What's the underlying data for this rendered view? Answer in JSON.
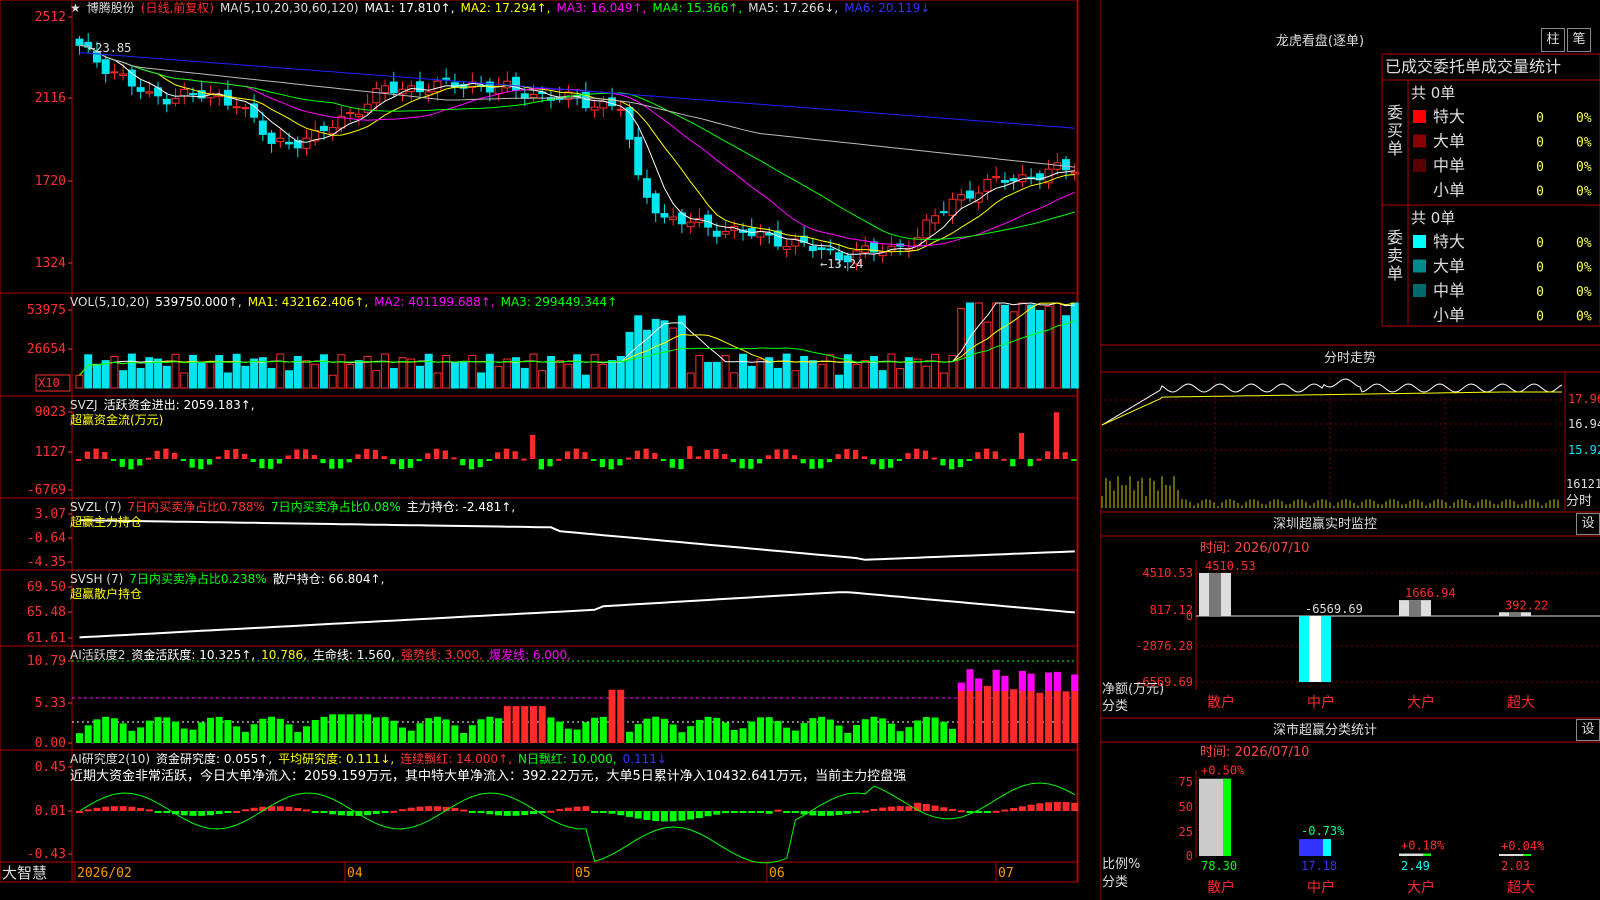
{
  "stock": {
    "name": "博腾股份",
    "mode": "(日线,前复权)"
  },
  "colors": {
    "up": "#ff2a2a",
    "down": "#00e5ee",
    "green": "#00ff00",
    "yellow": "#ffff00",
    "magenta": "#ff00ff",
    "white": "#ffffff",
    "blue": "#2020ff",
    "grid": "#b00000",
    "axis": "#ff3030"
  },
  "main_panel": {
    "ma_text": [
      {
        "t": "MA(5,10,20,30,60,120)",
        "c": "#dddddd"
      },
      {
        "t": "MA1: 17.810↑,",
        "c": "#ffffff"
      },
      {
        "t": "MA2: 17.294↑,",
        "c": "#ffff00"
      },
      {
        "t": "MA3: 16.049↑,",
        "c": "#ff00ff"
      },
      {
        "t": "MA4: 15.366↑,",
        "c": "#00ff00"
      },
      {
        "t": "MA5: 17.266↓,",
        "c": "#dddddd"
      },
      {
        "t": "MA6: 20.119↓",
        "c": "#3333ff"
      }
    ],
    "y_ticks": [
      "2512",
      "2116",
      "1720",
      "1324"
    ],
    "high_label": "23.85",
    "low_label": "13.24"
  },
  "vol_panel": {
    "text": [
      {
        "t": "VOL(5,10,20)",
        "c": "#dddddd"
      },
      {
        "t": "539750.000↑,",
        "c": "#ffffff"
      },
      {
        "t": "MA1: 432162.406↑,",
        "c": "#ffff00"
      },
      {
        "t": "MA2: 401199.688↑,",
        "c": "#ff00ff"
      },
      {
        "t": "MA3: 299449.344↑",
        "c": "#00ff00"
      }
    ],
    "y_ticks": [
      "53975",
      "26654"
    ],
    "unit": "X10"
  },
  "svzj_panel": {
    "line1": [
      {
        "t": "SVZJ",
        "c": "#dddddd"
      },
      {
        "t": "活跃资金进出: 2059.183↑,",
        "c": "#ffffff"
      }
    ],
    "line2": "超赢资金流(万元)",
    "y_ticks": [
      "9023",
      "1127",
      "-6769"
    ]
  },
  "svzl_panel": {
    "line1": [
      {
        "t": "SVZL (7)",
        "c": "#dddddd"
      },
      {
        "t": "7日内买卖净占比0.788%",
        "c": "#ff3030"
      },
      {
        "t": "7日内买卖净占比0.08%",
        "c": "#00ff00"
      },
      {
        "t": "主力持仓: -2.481↑,",
        "c": "#ffffff"
      }
    ],
    "line2": "超赢主力持仓",
    "y_ticks": [
      "3.07",
      "-0.64",
      "-4.35"
    ]
  },
  "svsh_panel": {
    "line1": [
      {
        "t": "SVSH (7)",
        "c": "#dddddd"
      },
      {
        "t": "7日内买卖净占比0.238%",
        "c": "#00ff00"
      },
      {
        "t": "散户持仓: 66.804↑,",
        "c": "#ffffff"
      }
    ],
    "line2": "超赢散户持仓",
    "y_ticks": [
      "69.50",
      "65.48",
      "61.61"
    ]
  },
  "ai_panel": {
    "line1": [
      {
        "t": "AI活跃度2",
        "c": "#dddddd"
      },
      {
        "t": "资金活跃度: 10.325↑,",
        "c": "#ffffff"
      },
      {
        "t": "10.786,",
        "c": "#ffff00"
      },
      {
        "t": "生命线: 1.560,",
        "c": "#ffffff"
      },
      {
        "t": "强势线: 3.000,",
        "c": "#ff3030"
      },
      {
        "t": "爆发线: 6.000,",
        "c": "#ff00ff"
      }
    ],
    "y_ticks": [
      "10.79",
      "5.33",
      "0.00"
    ]
  },
  "research_panel": {
    "line1": [
      {
        "t": "AI研究度2(10)",
        "c": "#dddddd"
      },
      {
        "t": "资金研究度: 0.055↑,",
        "c": "#ffffff"
      },
      {
        "t": "平均研究度: 0.111↓,",
        "c": "#ffff00"
      },
      {
        "t": "连续飘红: 14.000↑,",
        "c": "#ff3030"
      },
      {
        "t": "N日飘红: 10.000,",
        "c": "#00ff00"
      },
      {
        "t": "0.111↓",
        "c": "#3333ff"
      }
    ],
    "line2": "近期大资金非常活跃，今日大单净流入：2059.159万元，其中特大单净流入：392.22万元，大单5日累计净入10432.641万元，当前主力控盘强",
    "y_ticks": [
      "0.45",
      "0.01",
      "-0.43"
    ]
  },
  "date_axis": {
    "brand": "大智慧",
    "labels": [
      "2026/02",
      "04",
      "05",
      "06",
      "07"
    ]
  },
  "dragon_tiger": {
    "title": "龙虎看盘(逐单)",
    "btn_bar": "柱",
    "btn_pen": "笔",
    "header": "已成交委托单成交量统计",
    "buy": {
      "side": "委买单",
      "total": "共 0单",
      "rows": [
        {
          "label": "特大",
          "qty": "0",
          "pct": "0%",
          "c": "#ff0000"
        },
        {
          "label": "大单",
          "qty": "0",
          "pct": "0%",
          "c": "#8b0000"
        },
        {
          "label": "中单",
          "qty": "0",
          "pct": "0%",
          "c": "#5a0000"
        },
        {
          "label": "小单",
          "qty": "0",
          "pct": "0%",
          "c": "#000000"
        }
      ]
    },
    "sell": {
      "side": "委卖单",
      "total": "共 0单",
      "rows": [
        {
          "label": "特大",
          "qty": "0",
          "pct": "0%",
          "c": "#00ffff"
        },
        {
          "label": "大单",
          "qty": "0",
          "pct": "0%",
          "c": "#008b8b"
        },
        {
          "label": "中单",
          "qty": "0",
          "pct": "0%",
          "c": "#006a6a"
        },
        {
          "label": "小单",
          "qty": "0",
          "pct": "0%",
          "c": "#000000"
        }
      ]
    }
  },
  "intraday": {
    "title": "分时走势",
    "price_ticks": [
      "17.96",
      "16.94",
      "15.92"
    ],
    "vol_tick": "16121",
    "vol_unit": "分时"
  },
  "sz_monitor": {
    "title": "深圳超赢实时监控",
    "settings": "设",
    "time": "时间: 2026/07/10",
    "y_ticks": [
      "4510.53",
      "817.12",
      "0",
      "-2876.28",
      "-6569.69"
    ],
    "ylabel1": "净额(万元)",
    "ylabel2": "分类",
    "chart_data": {
      "type": "bar",
      "categories": [
        "散户",
        "中户",
        "大户",
        "超大"
      ],
      "values": [
        4510.53,
        -6569.69,
        1666.94,
        392.22
      ],
      "labels": [
        "4510.53",
        "-6569.69",
        "1666.94",
        "392.22"
      ],
      "ylim": [
        -6569.69,
        4510.53
      ]
    }
  },
  "sh_stats": {
    "title": "深市超赢分类统计",
    "settings": "设",
    "time": "时间: 2026/07/10",
    "y_ticks": [
      "75",
      "50",
      "25",
      "0"
    ],
    "ylabel1": "比例%",
    "ylabel2": "分类",
    "chart_data": {
      "type": "bar",
      "categories": [
        "散户",
        "中户",
        "大户",
        "超大"
      ],
      "values": [
        78.3,
        17.18,
        2.49,
        2.03
      ],
      "changes": [
        "+0.50%",
        "-0.73%",
        "+0.18%",
        "+0.04%"
      ],
      "value_labels": [
        "78.30",
        "17.18",
        "2.49",
        "2.03"
      ],
      "ylim": [
        0,
        80
      ]
    }
  }
}
